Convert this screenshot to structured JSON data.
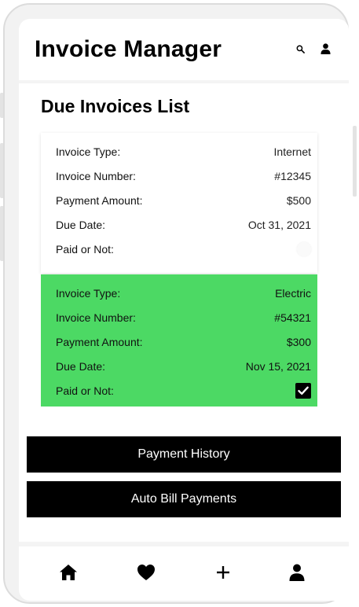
{
  "app": {
    "title": "Invoice Manager"
  },
  "header": {
    "icons": [
      "search-icon",
      "user-icon"
    ]
  },
  "section": {
    "title": "Due Invoices List"
  },
  "invoices": [
    {
      "labels": {
        "type": "Invoice Type:",
        "number": "Invoice Number:",
        "amount": "Payment Amount:",
        "due": "Due Date:",
        "paid": "Paid or Not:"
      },
      "type": "Internet",
      "number": "#12345",
      "amount": "$500",
      "due_date": "Oct 31, 2021",
      "paid": false,
      "background": "#ffffff"
    },
    {
      "labels": {
        "type": "Invoice Type:",
        "number": "Invoice Number:",
        "amount": "Payment Amount:",
        "due": "Due Date:",
        "paid": "Paid or Not:"
      },
      "type": "Electric",
      "number": "#54321",
      "amount": "$300",
      "due_date": "Nov 15, 2021",
      "paid": true,
      "background": "#4cd964"
    }
  ],
  "actions": {
    "history_label": "Payment History",
    "auto_label": "Auto Bill Payments"
  },
  "bottom_nav": {
    "items": [
      "home-icon",
      "heart-icon",
      "plus-icon",
      "profile-icon"
    ]
  },
  "colors": {
    "paid_green": "#4cd964",
    "button_bg": "#000000",
    "button_text": "#ffffff"
  }
}
